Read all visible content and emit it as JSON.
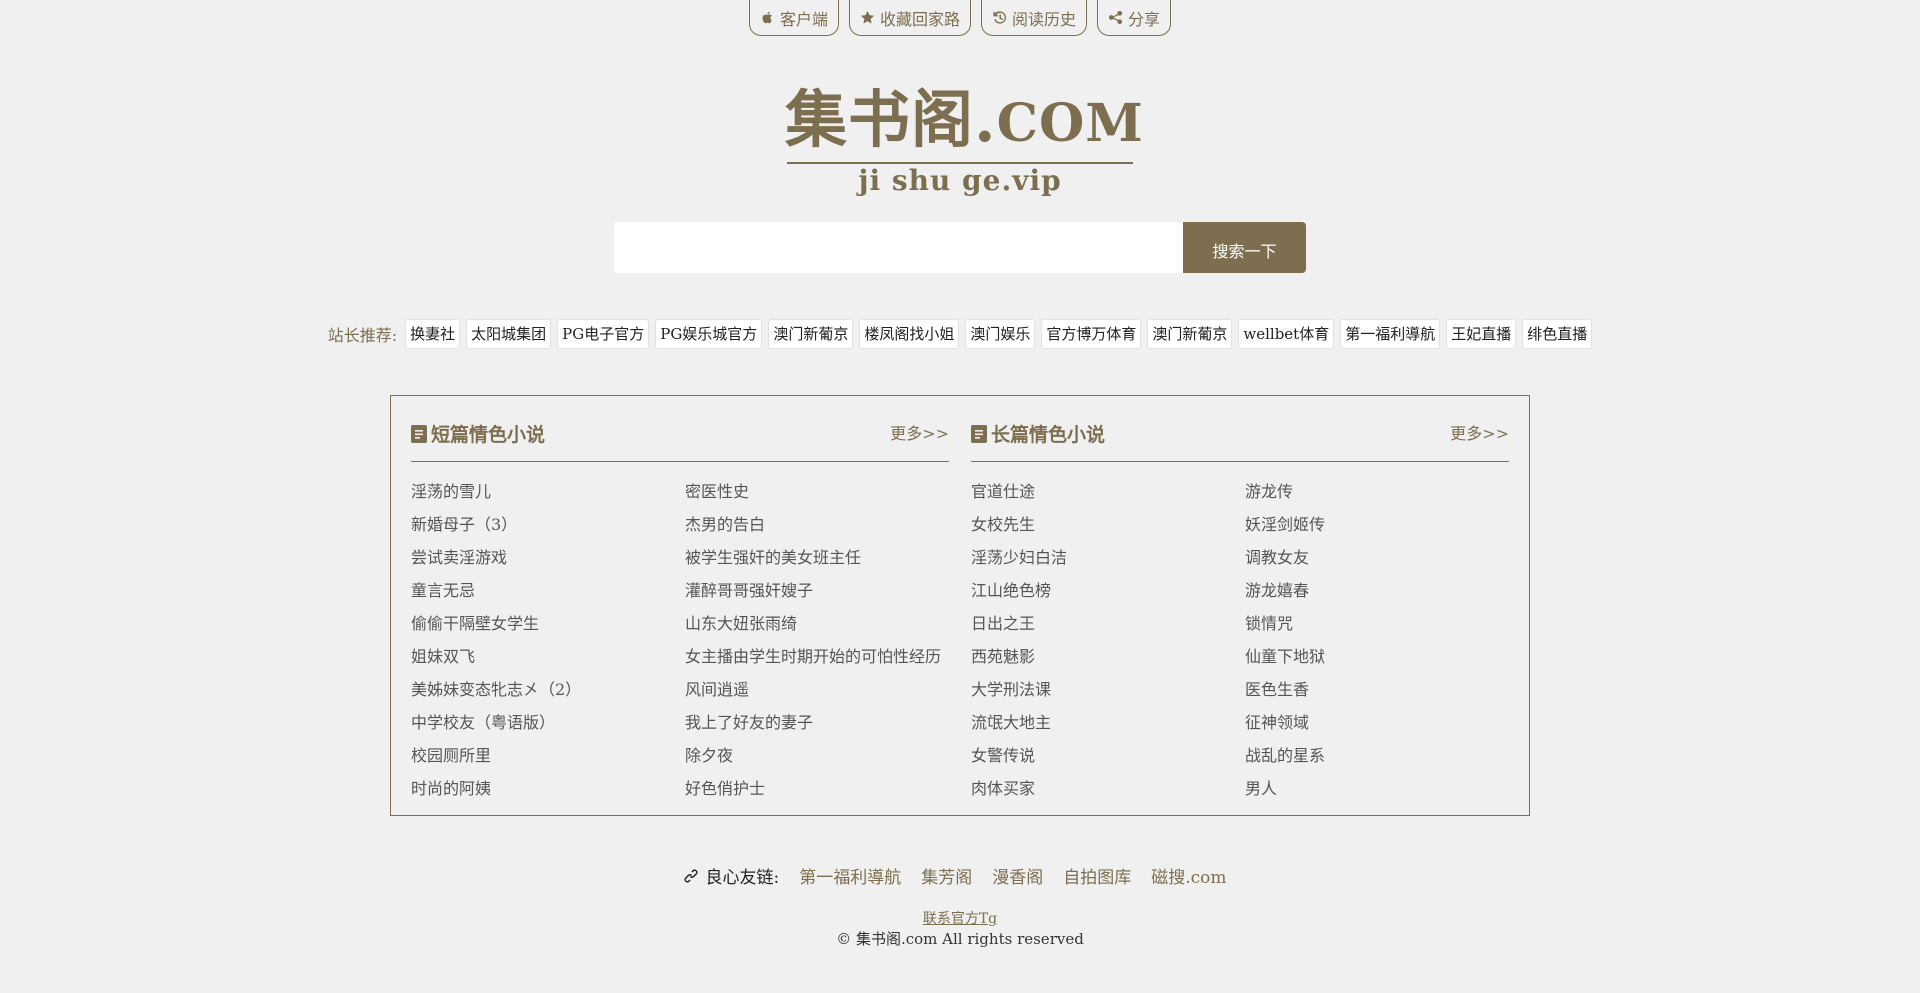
{
  "topnav": {
    "items": [
      {
        "label": "客户端",
        "icon": "apple-icon"
      },
      {
        "label": "收藏回家路",
        "icon": "star-icon"
      },
      {
        "label": "阅读历史",
        "icon": "history-icon"
      },
      {
        "label": "分享",
        "icon": "share-icon"
      }
    ]
  },
  "logo": {
    "main": "集书阁.",
    "com": "COM",
    "sub": "ji shu ge.vip"
  },
  "search": {
    "placeholder": "",
    "button_label": "搜索一下"
  },
  "recommend": {
    "label": "站长推荐:",
    "tags": [
      "换妻社",
      "太阳城集团",
      "PG电子官方",
      "PG娱乐城官方",
      "澳门新葡京",
      "楼凤阁找小姐",
      "澳门娱乐",
      "官方博万体育",
      "澳门新葡京",
      "wellbet体育",
      "第一福利導航",
      "王妃直播",
      "绯色直播"
    ]
  },
  "short": {
    "title": "短篇情色小说",
    "more": "更多>>",
    "items": [
      "淫荡的雪儿",
      "密医性史",
      "新婚母子（3）",
      "杰男的告白",
      "尝试卖淫游戏",
      "被学生强奸的美女班主任",
      "童言无忌",
      "灌醉哥哥强奸嫂子",
      "偷偷干隔壁女学生",
      "山东大妞张雨绮",
      "姐妹双飞",
      "女主播由学生时期开始的可怕性经历",
      "美姊妹变态牝志㐅（2）",
      "风间逍遥",
      "中学校友（粤语版）",
      "我上了好友的妻子",
      "校园厕所里",
      "除夕夜",
      "时尚的阿姨",
      "好色俏护士"
    ]
  },
  "long": {
    "title": "长篇情色小说",
    "more": "更多>>",
    "items": [
      "官道仕途",
      "游龙传",
      "女校先生",
      "妖淫剑姬传",
      "淫荡少妇白洁",
      "调教女友",
      "江山绝色榜",
      "游龙嬉春",
      "日出之王",
      "锁情咒",
      "西苑魅影",
      "仙童下地狱",
      "大学刑法课",
      "医色生香",
      "流氓大地主",
      "征神领域",
      "女警传说",
      "战乱的星系",
      "肉体买家",
      "男人"
    ]
  },
  "footer": {
    "links_label": "良心友链:",
    "links": [
      "第一福利導航",
      "集芳阁",
      "漫香阁",
      "自拍图库",
      "磁搜.com"
    ],
    "contact": "联系官方Tg",
    "copyright": "© 集书阁.com All rights reserved"
  }
}
